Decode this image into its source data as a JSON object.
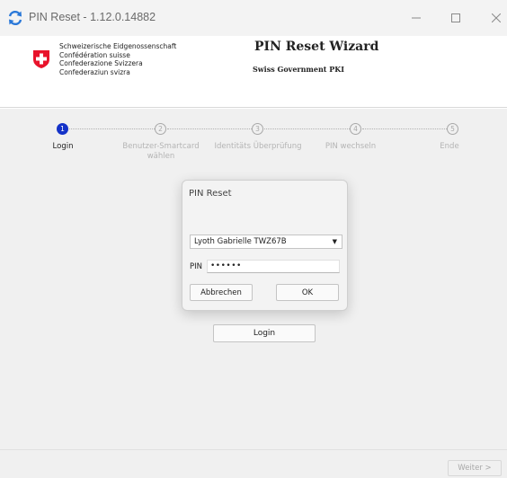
{
  "window": {
    "title": "PIN Reset - 1.12.0.14882",
    "minimize_icon": "minimize-icon",
    "maximize_icon": "maximize-icon",
    "close_icon": "close-icon"
  },
  "header": {
    "confederation_lines": [
      "Schweizerische Eidgenossenschaft",
      "Confédération suisse",
      "Confederazione Svizzera",
      "Confederaziun svizra"
    ],
    "wizard_title": "PIN Reset Wizard",
    "wizard_subtitle": "Swiss Government PKI"
  },
  "steps": [
    {
      "number": "1",
      "label": "Login",
      "active": true
    },
    {
      "number": "2",
      "label": "Benutzer-Smartcard wählen",
      "active": false
    },
    {
      "number": "3",
      "label": "Identitäts Überprüfung",
      "active": false
    },
    {
      "number": "4",
      "label": "PIN wechseln",
      "active": false
    },
    {
      "number": "5",
      "label": "Ende",
      "active": false
    }
  ],
  "main": {
    "login_button": "Login"
  },
  "dialog": {
    "title": "PIN Reset",
    "card_select": "Lyoth Gabrielle TWZ67B",
    "pin_label": "PIN",
    "pin_value": "••••••",
    "cancel_button": "Abbrechen",
    "ok_button": "OK"
  },
  "footer": {
    "next_button": "Weiter >"
  },
  "colors": {
    "active_step": "#1432c8",
    "swiss_red": "#e8132b",
    "inactive_text": "#b4b4b4"
  }
}
